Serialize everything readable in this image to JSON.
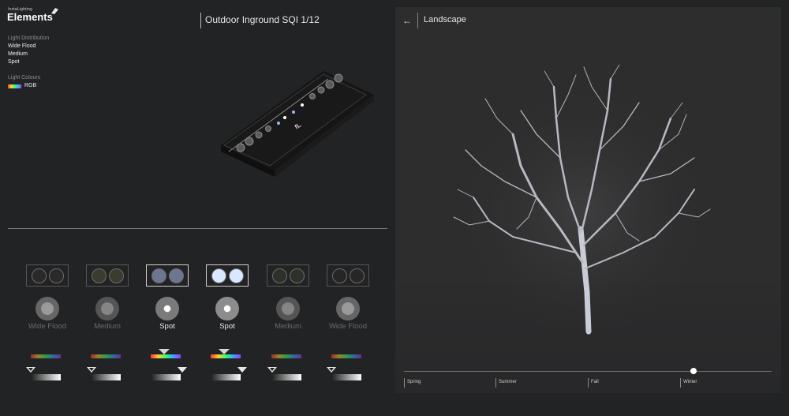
{
  "brand": {
    "small": "InstaLighting",
    "name": "Elements"
  },
  "specs": {
    "distribution_heading": "Light Distribution",
    "distributions": [
      "Wide Flood",
      "Medium",
      "Spot"
    ],
    "colours_heading": "Light Colours",
    "colour_value": "RGB"
  },
  "product": {
    "title": "Outdoor Inground SQI 1/12"
  },
  "variants": [
    {
      "label": "Wide Flood",
      "selected": false,
      "lens_color": "#2a2a2a",
      "beam_outer": "#666666",
      "beam_inner": "#9a9a9a",
      "label_color": "#6a6a6a"
    },
    {
      "label": "Medium",
      "selected": false,
      "lens_color": "#3a3c30",
      "beam_outer": "#555555",
      "beam_inner": "#858585",
      "label_color": "#6a6a6a"
    },
    {
      "label": "Spot",
      "selected": true,
      "lens_color": "#6b7690",
      "beam_outer": "#7a7a7a",
      "beam_inner": "#ffffff",
      "label_color": "#e9e9e9"
    },
    {
      "label": "Spot",
      "selected": true,
      "lens_color": "#d9e9ff",
      "beam_outer": "#8c8c8c",
      "beam_inner": "#ffffff",
      "label_color": "#e9e9e9"
    },
    {
      "label": "Medium",
      "selected": false,
      "lens_color": "#2e3127",
      "beam_outer": "#555555",
      "beam_inner": "#858585",
      "label_color": "#6a6a6a"
    },
    {
      "label": "Wide Flood",
      "selected": false,
      "lens_color": "#262626",
      "beam_outer": "#666666",
      "beam_inner": "#9a9a9a",
      "label_color": "#6a6a6a"
    }
  ],
  "scene": {
    "title": "Landscape",
    "back_icon": "arrow-left-icon",
    "seasons": [
      "Spring",
      "Summer",
      "Fall",
      "Winter"
    ],
    "selected_season": "Winter"
  }
}
